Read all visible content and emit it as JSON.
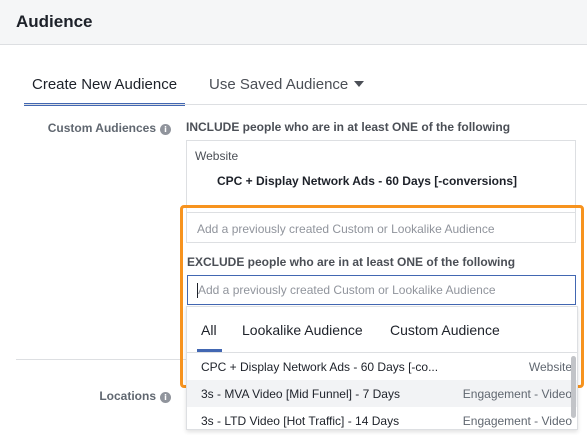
{
  "header": {
    "title": "Audience"
  },
  "tabs": {
    "create_label": "Create New Audience",
    "saved_label": "Use Saved Audience"
  },
  "custom_audiences": {
    "label": "Custom Audiences",
    "include_heading": "INCLUDE people who are in at least ONE of the following",
    "include_group": "Website",
    "include_item": "CPC + Display Network Ads - 60 Days [-conversions]",
    "include_placeholder": "Add a previously created Custom or Lookalike Audience",
    "exclude_heading": "EXCLUDE people who are in at least ONE of the following",
    "exclude_placeholder": "Add a previously created Custom or Lookalike Audience"
  },
  "locations": {
    "label": "Locations"
  },
  "dropdown": {
    "tabs": [
      "All",
      "Lookalike Audience",
      "Custom Audience"
    ],
    "items": [
      {
        "name": "CPC + Display Network Ads - 60 Days [-co...",
        "type": "Website"
      },
      {
        "name": "3s - MVA Video [Mid Funnel] - 7 Days",
        "type": "Engagement - Video"
      },
      {
        "name": "3s - LTD Video [Hot Traffic] - 14 Days",
        "type": "Engagement - Video"
      }
    ]
  },
  "colors": {
    "accent": "#4267b2",
    "highlight_frame": "#f7931e"
  }
}
